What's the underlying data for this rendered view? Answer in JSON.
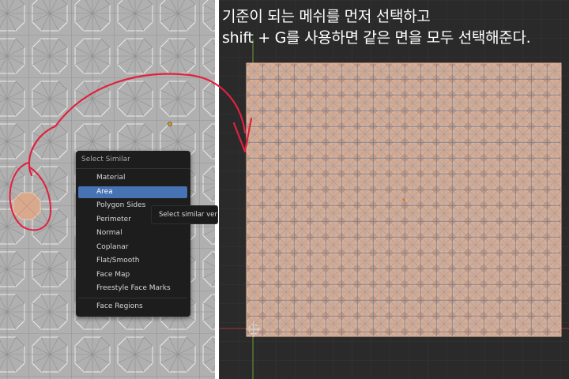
{
  "caption": {
    "line1": "기준이 되는 메쉬를 먼저 선택하고",
    "line2": "shift + G를 사용하면 같은 면을 모두 선택해준다."
  },
  "menu": {
    "title": "Select Similar",
    "items": [
      {
        "label": "Material"
      },
      {
        "label": "Area"
      },
      {
        "label": "Polygon Sides"
      },
      {
        "label": "Perimeter"
      },
      {
        "label": "Normal"
      },
      {
        "label": "Coplanar"
      },
      {
        "label": "Flat/Smooth"
      },
      {
        "label": "Face Map"
      },
      {
        "label": "Freestyle Face Marks"
      },
      {
        "label": "Face Regions"
      }
    ],
    "active_item": "Area"
  },
  "tooltip": {
    "text": "Select similar vert"
  },
  "colors": {
    "menu_highlight": "#4772b3",
    "selected_face": "#d8a98c",
    "arrow": "#e0213f",
    "edge_blue": "#3f7fb4"
  }
}
